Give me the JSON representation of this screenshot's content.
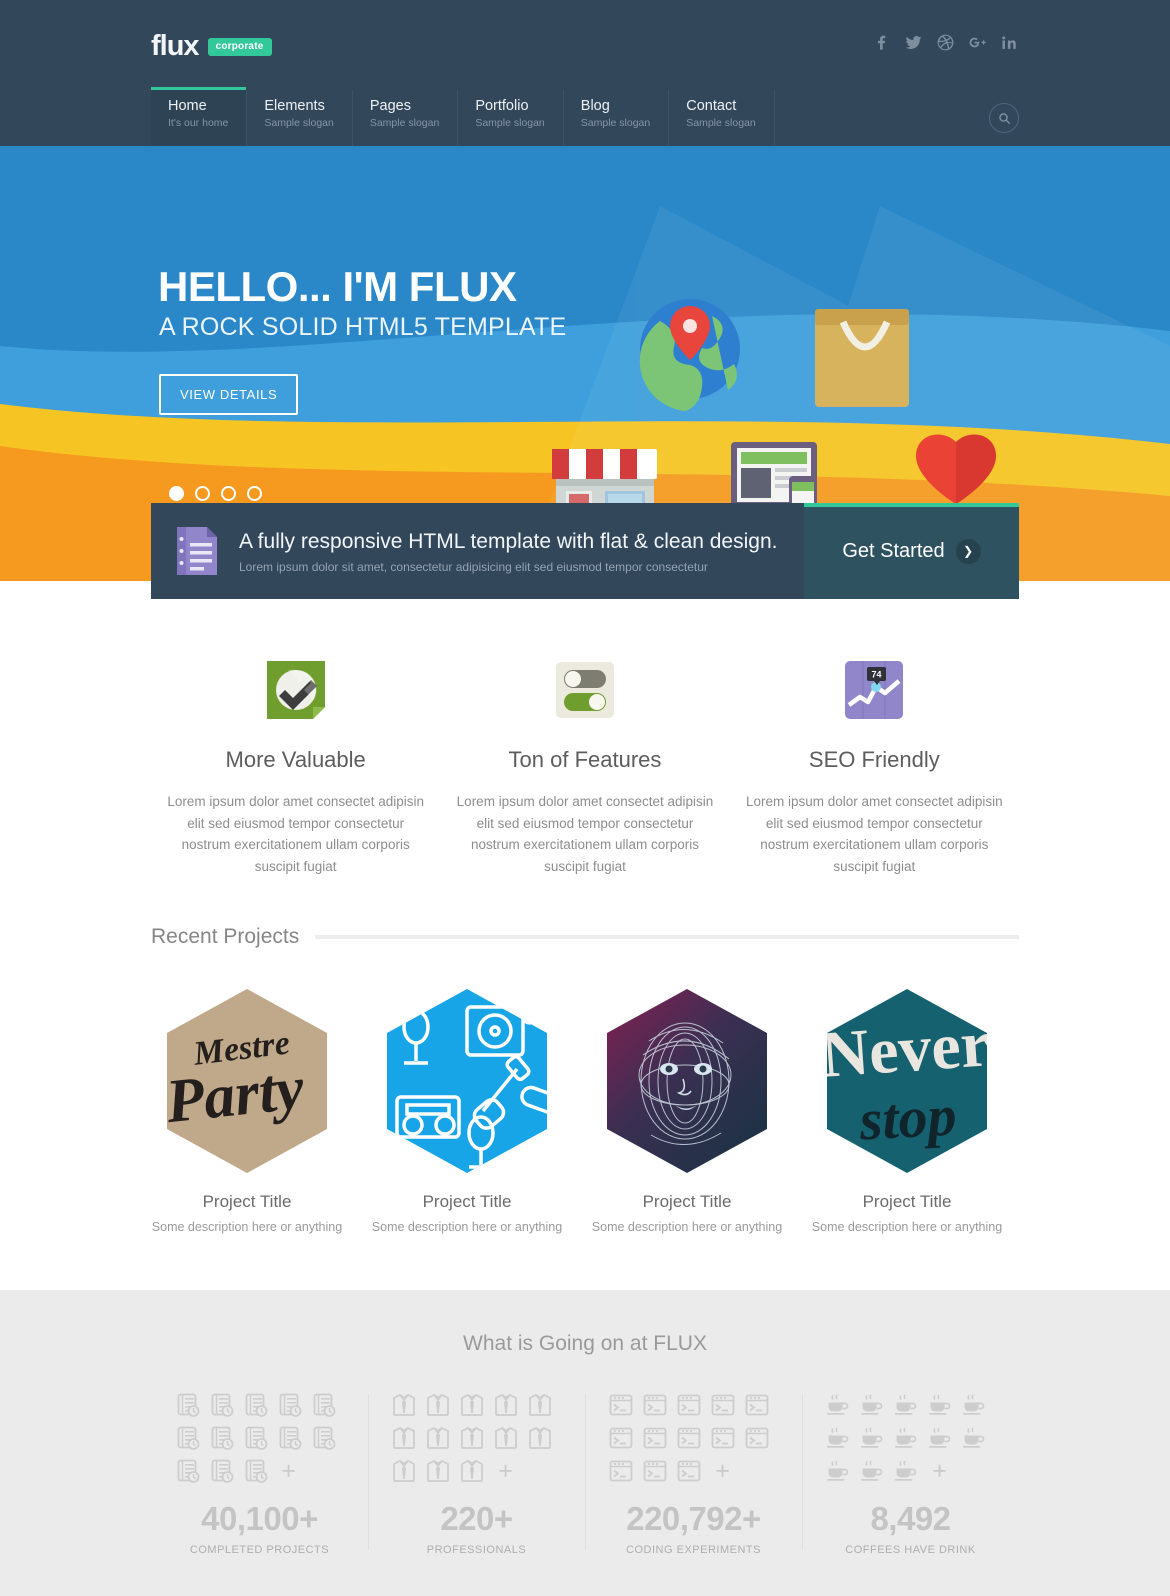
{
  "brand": {
    "name": "flux",
    "badge": "corporate",
    "accent": "#33c89a",
    "header_bg": "#33475b"
  },
  "social": [
    {
      "name": "facebook-icon",
      "label": "Facebook"
    },
    {
      "name": "twitter-icon",
      "label": "Twitter"
    },
    {
      "name": "dribbble-icon",
      "label": "Dribbble"
    },
    {
      "name": "googleplus-icon",
      "label": "Google Plus"
    },
    {
      "name": "linkedin-icon",
      "label": "LinkedIn"
    }
  ],
  "nav": {
    "items": [
      {
        "label": "Home",
        "slogan": "It's our home",
        "active": true
      },
      {
        "label": "Elements",
        "slogan": "Sample slogan",
        "active": false
      },
      {
        "label": "Pages",
        "slogan": "Sample slogan",
        "active": false
      },
      {
        "label": "Portfolio",
        "slogan": "Sample slogan",
        "active": false
      },
      {
        "label": "Blog",
        "slogan": "Sample slogan",
        "active": false
      },
      {
        "label": "Contact",
        "slogan": "Sample slogan",
        "active": false
      }
    ],
    "search_icon": "search-icon"
  },
  "hero": {
    "title": "HELLO... I'M FLUX",
    "subtitle": "A ROCK SOLID HTML5 TEMPLATE",
    "button": "VIEW DETAILS",
    "slides": 4,
    "active_slide": 1,
    "bg_primary": "#2a87c8",
    "bg_secondary": "#3e9fdc",
    "bg_yellow": "#f6c523",
    "bg_orange": "#f59a1f",
    "icons": [
      "globe-pin-icon",
      "shopping-bag-icon",
      "storefront-icon",
      "responsive-devices-icon",
      "heart-icon",
      "clock-icon",
      "retro-tv-icon"
    ]
  },
  "promo": {
    "icon": "document-list-icon",
    "title": "A fully responsive HTML template with flat & clean design.",
    "subtitle": "Lorem ipsum dolor sit amet, consectetur adipisicing elit sed eiusmod tempor consectetur",
    "cta": "Get Started",
    "cta_icon": "chevron-right-icon"
  },
  "features": [
    {
      "icon": "check-badge-icon",
      "title": "More Valuable",
      "desc": "Lorem ipsum dolor amet consectet adipisin elit sed eiusmod tempor consectetur nostrum exercitationem ullam corporis suscipit fugiat"
    },
    {
      "icon": "toggle-switches-icon",
      "title": "Ton of Features",
      "desc": "Lorem ipsum dolor amet consectet adipisin elit sed eiusmod tempor consectetur nostrum exercitationem ullam corporis suscipit fugiat"
    },
    {
      "icon": "analytics-chart-icon",
      "title": "SEO Friendly",
      "desc": "Lorem ipsum dolor amet consectet adipisin elit sed eiusmod tempor consectetur nostrum exercitationem ullam corporis suscipit fugiat",
      "badge_value": "74"
    }
  ],
  "recent_projects": {
    "heading": "Recent Projects",
    "items": [
      {
        "title": "Project Title",
        "desc": "Some description here or anything",
        "art": "mestre-party-lettering",
        "colors": [
          "#c4ad90",
          "#241f1c"
        ]
      },
      {
        "title": "Project Title",
        "desc": "Some description here or anything",
        "art": "music-instruments-pattern",
        "colors": [
          "#18a5e8",
          "#ffffff"
        ]
      },
      {
        "title": "Project Title",
        "desc": "Some description here or anything",
        "art": "wireframe-face-portrait",
        "colors": [
          "#2a3a52",
          "#8f1d52"
        ]
      },
      {
        "title": "Project Title",
        "desc": "Some description here or anything",
        "art": "never-stop-lettering",
        "colors": [
          "#15616f",
          "#e8e6df"
        ]
      }
    ]
  },
  "stats": {
    "heading": "What is Going on at FLUX",
    "items": [
      {
        "value": "40,100+",
        "label": "COMPLETED PROJECTS",
        "icon": "notebook-clock-icon",
        "icon_count": 13,
        "plus": "+"
      },
      {
        "value": "220+",
        "label": "PROFESSIONALS",
        "icon": "shirt-tie-icon",
        "icon_count": 13,
        "plus": "+"
      },
      {
        "value": "220,792+",
        "label": "CODING EXPERIMENTS",
        "icon": "terminal-window-icon",
        "icon_count": 13,
        "plus": "+"
      },
      {
        "value": "8,492",
        "label": "COFFEES HAVE DRINK",
        "icon": "coffee-cup-icon",
        "icon_count": 13,
        "plus": "+"
      }
    ]
  }
}
